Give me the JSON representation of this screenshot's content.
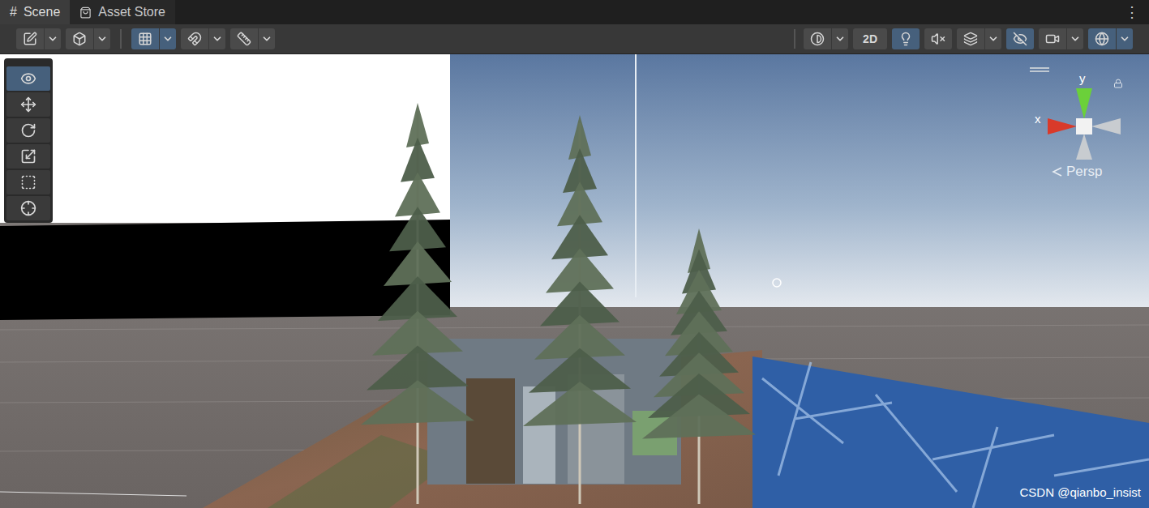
{
  "tabs": [
    {
      "label": "Scene",
      "glyph": "#",
      "selected": true
    },
    {
      "label": "Asset Store",
      "glyph": "",
      "selected": false
    }
  ],
  "menu_glyph": "⋮",
  "toolbar": {
    "left": [
      {
        "kind": "draw-mode",
        "selected": false,
        "dropdown": true
      },
      {
        "kind": "shading",
        "selected": false,
        "dropdown": true
      },
      {
        "kind": "grid-snap",
        "selected": true,
        "dropdown": true
      },
      {
        "kind": "increment-snap",
        "selected": false,
        "dropdown": true
      },
      {
        "kind": "grid",
        "selected": false,
        "dropdown": true
      }
    ],
    "right": [
      {
        "kind": "render-mode",
        "label": "",
        "selected": false,
        "dropdown": true
      },
      {
        "kind": "2d",
        "label": "2D",
        "selected": false,
        "dropdown": false
      },
      {
        "kind": "lighting",
        "label": "",
        "selected": true,
        "dropdown": false
      },
      {
        "kind": "audio",
        "label": "",
        "selected": false,
        "dropdown": false
      },
      {
        "kind": "effects",
        "label": "",
        "selected": false,
        "dropdown": true
      },
      {
        "kind": "visibility",
        "label": "",
        "selected": true,
        "dropdown": false
      },
      {
        "kind": "camera",
        "label": "",
        "selected": false,
        "dropdown": true
      },
      {
        "kind": "gizmos",
        "label": "",
        "selected": true,
        "dropdown": true
      }
    ]
  },
  "tools": [
    {
      "kind": "view",
      "selected": true
    },
    {
      "kind": "move",
      "selected": false
    },
    {
      "kind": "rotate",
      "selected": false
    },
    {
      "kind": "scale",
      "selected": false
    },
    {
      "kind": "rect",
      "selected": false
    },
    {
      "kind": "transform",
      "selected": false
    }
  ],
  "gizmo": {
    "y_label": "y",
    "x_label": "x",
    "projection": "Persp",
    "locked": false
  },
  "watermark": "CSDN @qianbo_insist"
}
